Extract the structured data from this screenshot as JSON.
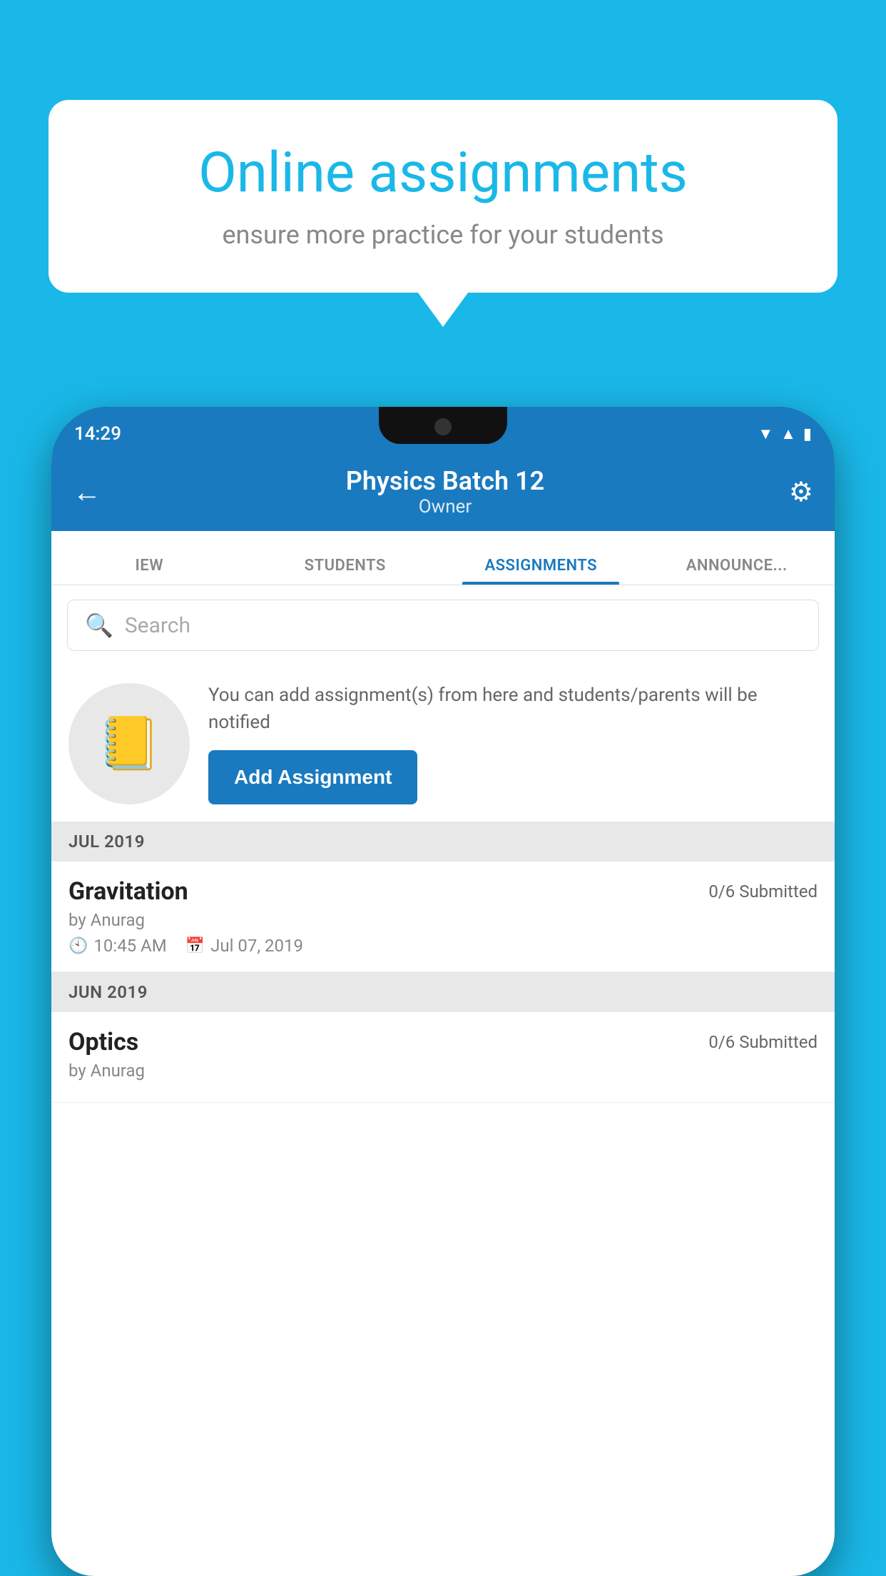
{
  "background": {
    "color": "#1ab8e8"
  },
  "speech_bubble": {
    "title": "Online assignments",
    "subtitle": "ensure more practice for your students"
  },
  "status_bar": {
    "time": "14:29",
    "icons": "▼ ▲ ▮"
  },
  "app_header": {
    "title": "Physics Batch 12",
    "subtitle": "Owner",
    "back_label": "←",
    "settings_label": "⚙"
  },
  "tabs": [
    {
      "label": "IEW",
      "active": false
    },
    {
      "label": "STUDENTS",
      "active": false
    },
    {
      "label": "ASSIGNMENTS",
      "active": true
    },
    {
      "label": "ANNOUNCE...",
      "active": false
    }
  ],
  "search": {
    "placeholder": "Search"
  },
  "assignment_promo": {
    "icon": "📒",
    "description": "You can add assignment(s) from here and students/parents will be notified",
    "button_label": "Add Assignment"
  },
  "sections": [
    {
      "month_label": "JUL 2019",
      "assignments": [
        {
          "name": "Gravitation",
          "submitted": "0/6 Submitted",
          "by": "by Anurag",
          "time": "10:45 AM",
          "date": "Jul 07, 2019"
        }
      ]
    },
    {
      "month_label": "JUN 2019",
      "assignments": [
        {
          "name": "Optics",
          "submitted": "0/6 Submitted",
          "by": "by Anurag",
          "time": "",
          "date": ""
        }
      ]
    }
  ]
}
